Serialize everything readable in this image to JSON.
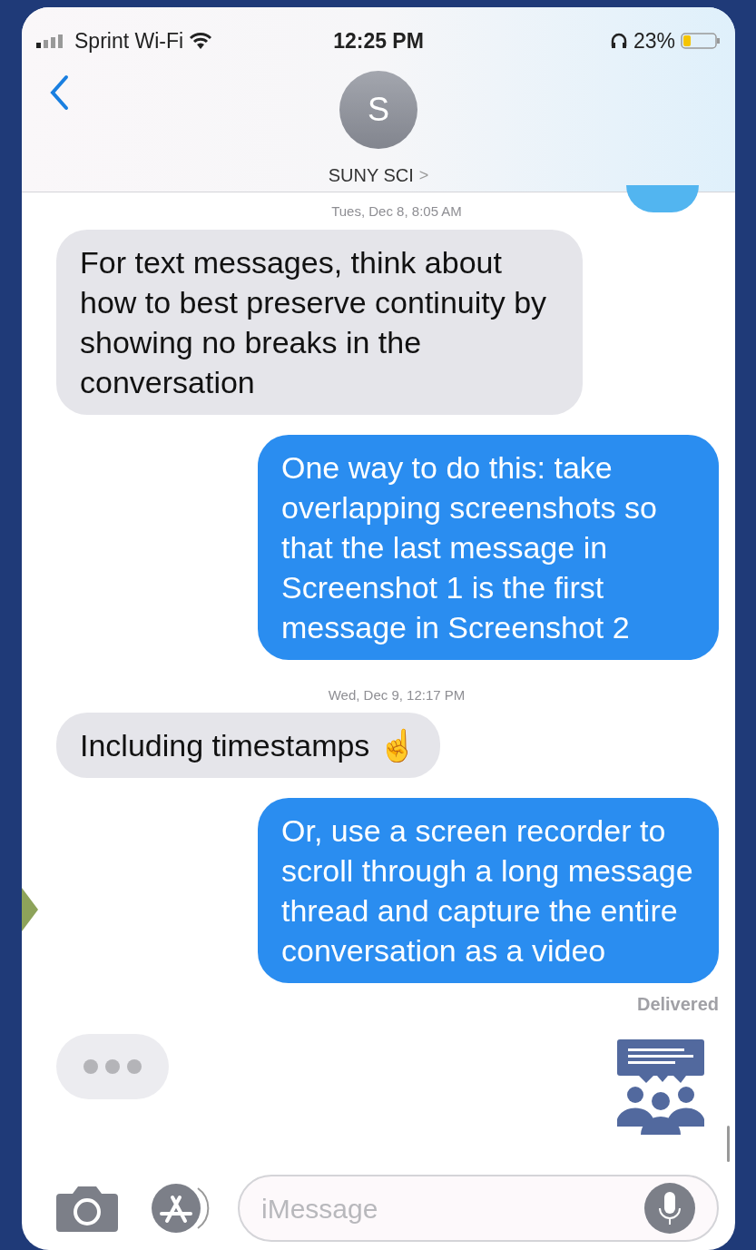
{
  "status_bar": {
    "carrier": "Sprint Wi-Fi",
    "time": "12:25 PM",
    "battery": "23%"
  },
  "header": {
    "avatar_letter": "S",
    "contact": "SUNY SCI",
    "chevron": ">"
  },
  "messages": [
    {
      "kind": "timestamp",
      "text": "Tues, Dec 8, 8:05 AM"
    },
    {
      "kind": "incoming",
      "text": "For text messages, think about how to best preserve continuity by showing no breaks in the conversation"
    },
    {
      "kind": "outgoing",
      "text": "One way to do this: take overlapping screenshots so that the last message in Screenshot 1 is the first message in Screenshot 2"
    },
    {
      "kind": "timestamp",
      "text": "Wed, Dec 9, 12:17 PM"
    },
    {
      "kind": "incoming",
      "text": "Including timestamps ☝️"
    },
    {
      "kind": "outgoing",
      "text": "Or, use a screen recorder to scroll through a long message thread and capture the entire conversation as a video"
    },
    {
      "kind": "delivered",
      "text": "Delivered"
    },
    {
      "kind": "typing"
    }
  ],
  "composer": {
    "placeholder": "iMessage"
  }
}
